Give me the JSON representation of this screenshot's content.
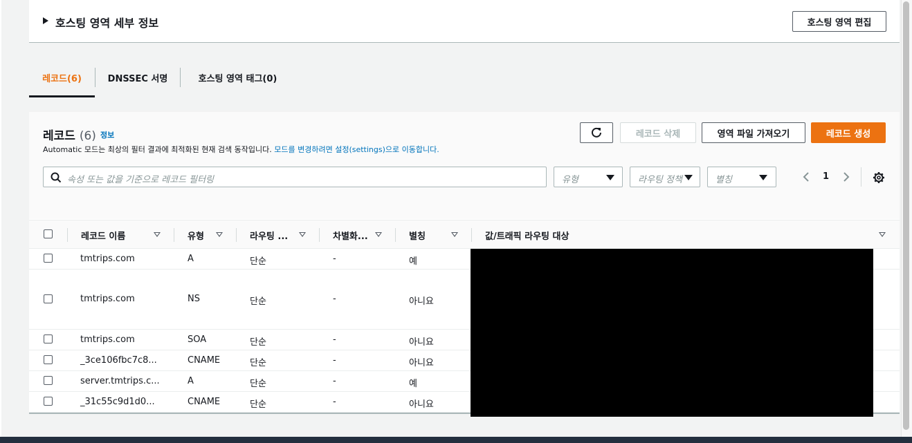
{
  "details": {
    "title": "호스팅 영역 세부 정보",
    "edit_button": "호스팅 영역 편집"
  },
  "tabs": [
    {
      "label": "레코드(6)",
      "active": true
    },
    {
      "label": "DNSSEC 서명",
      "active": false
    },
    {
      "label": "호스팅 영역 태그(0)",
      "active": false
    }
  ],
  "records": {
    "title": "레코드",
    "count": "(6)",
    "info": "정보",
    "description": "Automatic 모드는 최상의 필터 결과에 최적화된 현재 검색 동작입니다.",
    "description_link": "모드를 변경하려면 설정(settings)으로 이동합니다.",
    "buttons": {
      "delete": "레코드 삭제",
      "import": "영역 파일 가져오기",
      "create": "레코드 생성"
    },
    "search_placeholder": "속성 또는 값을 기준으로 레코드 필터링",
    "filters": {
      "type": "유형",
      "routing_policy": "라우팅 정책",
      "alias": "별칭"
    },
    "page": "1",
    "columns": [
      "레코드 이름",
      "유형",
      "라우팅 ...",
      "차별화...",
      "별칭",
      "값/트래픽 라우팅 대상"
    ],
    "rows": [
      {
        "name": "tmtrips.com",
        "type": "A",
        "routing": "단순",
        "diff": "-",
        "alias": "예"
      },
      {
        "name": "tmtrips.com",
        "type": "NS",
        "routing": "단순",
        "diff": "-",
        "alias": "아니요"
      },
      {
        "name": "tmtrips.com",
        "type": "SOA",
        "routing": "단순",
        "diff": "-",
        "alias": "아니요"
      },
      {
        "name": "_3ce106fbc7c8...",
        "type": "CNAME",
        "routing": "단순",
        "diff": "-",
        "alias": "아니요"
      },
      {
        "name": "server.tmtrips.c...",
        "type": "A",
        "routing": "단순",
        "diff": "-",
        "alias": "예"
      },
      {
        "name": "_31c55c9d1d0...",
        "type": "CNAME",
        "routing": "단순",
        "diff": "-",
        "alias": "아니요"
      }
    ]
  },
  "colors": {
    "accent": "#ec7211",
    "link": "#0073bb",
    "text": "#16191f"
  }
}
